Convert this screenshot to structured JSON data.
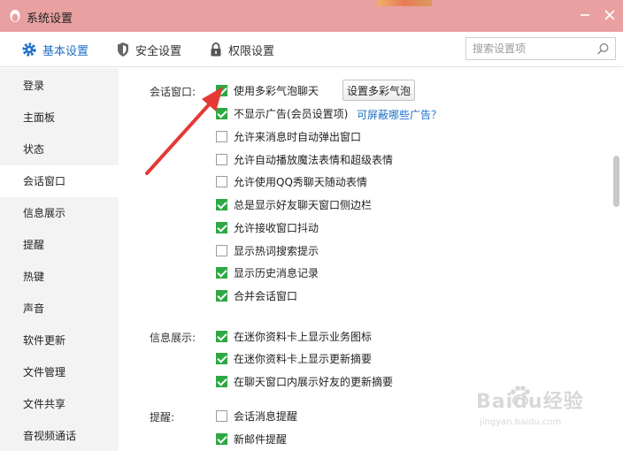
{
  "window": {
    "title": "系统设置"
  },
  "tabs": [
    {
      "label": "基本设置",
      "icon": "gear-icon",
      "active": true
    },
    {
      "label": "安全设置",
      "icon": "shield-icon",
      "active": false
    },
    {
      "label": "权限设置",
      "icon": "lock-icon",
      "active": false
    }
  ],
  "search": {
    "placeholder": "搜索设置项",
    "value": ""
  },
  "sidebar": {
    "items": [
      {
        "label": "登录"
      },
      {
        "label": "主面板"
      },
      {
        "label": "状态"
      },
      {
        "label": "会话窗口",
        "active": true
      },
      {
        "label": "信息展示"
      },
      {
        "label": "提醒"
      },
      {
        "label": "热键"
      },
      {
        "label": "声音"
      },
      {
        "label": "软件更新"
      },
      {
        "label": "文件管理"
      },
      {
        "label": "文件共享"
      },
      {
        "label": "音视频通话"
      }
    ]
  },
  "sections": {
    "chat_window": {
      "label": "会话窗口:",
      "bubble_button": "设置多彩气泡",
      "ad_link": "可屏蔽哪些广告？",
      "options": [
        {
          "label": "使用多彩气泡聊天",
          "checked": true
        },
        {
          "label": "不显示广告(会员设置项)",
          "checked": true
        },
        {
          "label": "允许来消息时自动弹出窗口",
          "checked": false
        },
        {
          "label": "允许自动播放魔法表情和超级表情",
          "checked": false
        },
        {
          "label": "允许使用QQ秀聊天随动表情",
          "checked": false
        },
        {
          "label": "总是显示好友聊天窗口侧边栏",
          "checked": true
        },
        {
          "label": "允许接收窗口抖动",
          "checked": true
        },
        {
          "label": "显示热词搜索提示",
          "checked": false
        },
        {
          "label": "显示历史消息记录",
          "checked": true
        },
        {
          "label": "合并会话窗口",
          "checked": true
        }
      ]
    },
    "info_display": {
      "label": "信息展示:",
      "options": [
        {
          "label": "在迷你资料卡上显示业务图标",
          "checked": true
        },
        {
          "label": "在迷你资料卡上显示更新摘要",
          "checked": true
        },
        {
          "label": "在聊天窗口内展示好友的更新摘要",
          "checked": true
        }
      ]
    },
    "reminder": {
      "label": "提醒:",
      "options": [
        {
          "label": "会话消息提醒",
          "checked": false
        },
        {
          "label": "新邮件提醒",
          "checked": true
        }
      ]
    }
  },
  "colors": {
    "titlebar": "#e8a0a0",
    "accent": "#1e6fc6",
    "check": "#2ea843",
    "arrow": "#e53935"
  },
  "watermark": {
    "brand": "Baidu经验",
    "url": "jingyan.baidu.com"
  }
}
